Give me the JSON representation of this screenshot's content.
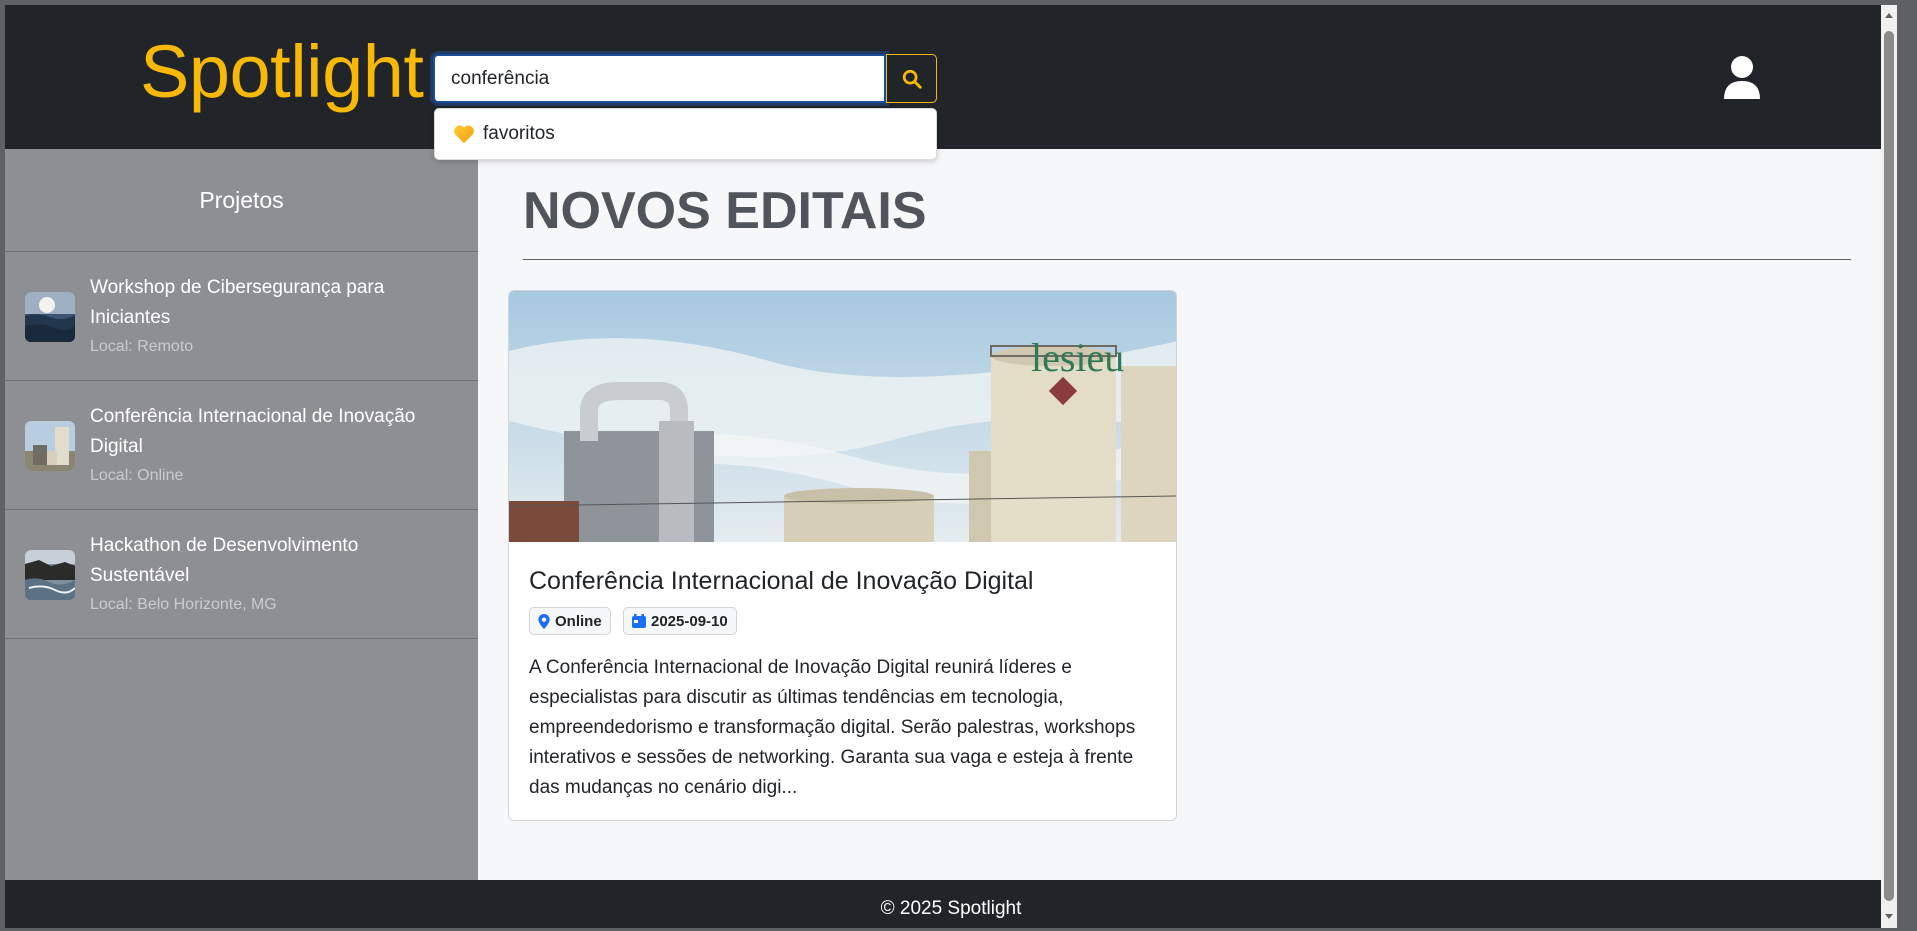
{
  "header": {
    "brand": "Spotlight",
    "search": {
      "value": "conferência",
      "placeholder": ""
    },
    "suggestion": {
      "label": "favoritos"
    }
  },
  "sidebar": {
    "title": "Projetos",
    "items": [
      {
        "name": "Workshop de Cibersegurança para Iniciantes",
        "location": "Local: Remoto"
      },
      {
        "name": "Conferência Internacional de Inovação Digital",
        "location": "Local: Online"
      },
      {
        "name": "Hackathon de Desenvolvimento Sustentável",
        "location": "Local: Belo Horizonte, MG"
      }
    ]
  },
  "main": {
    "title": "NOVOS EDITAIS",
    "card": {
      "title": "Conferência Internacional de Inovação Digital",
      "mode": "Online",
      "date": "2025-09-10",
      "description": "A Conferência Internacional de Inovação Digital reunirá líderes e especialistas para discutir as últimas tendências em tecnologia, empreendedorismo e transformação digital. Serão palestras, workshops interativos e sessões de networking. Garanta sua vaga e esteja à frente das mudanças no cenário digi...",
      "image_sign": "lesieu"
    }
  },
  "footer": {
    "text": "© 2025 Spotlight"
  },
  "colors": {
    "brand": "#f7b808",
    "header_bg": "#212429",
    "sidebar_bg": "#8d8f92",
    "main_bg": "#f6f7f9",
    "badge_icon": "#1a6ef5"
  },
  "icons": {
    "search": "search-icon",
    "user": "user-icon",
    "heart": "heart-icon",
    "location": "map-pin-icon",
    "calendar": "calendar-icon"
  }
}
